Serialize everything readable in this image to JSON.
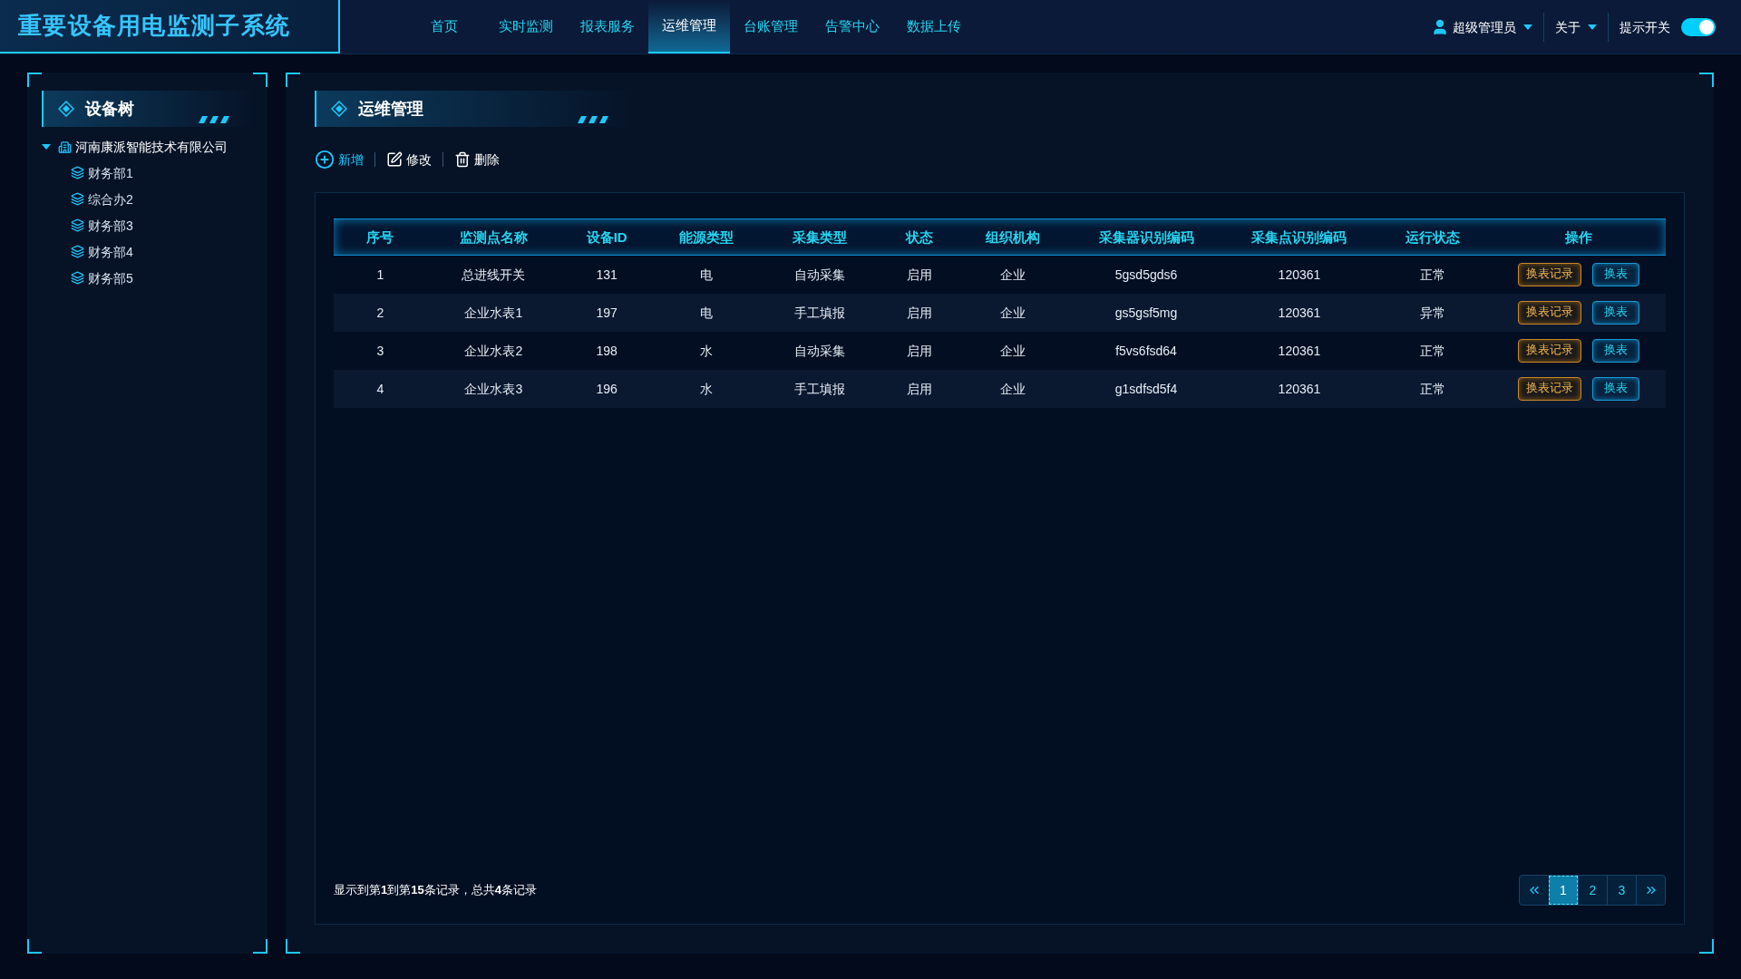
{
  "app_title": "重要设备用电监测子系统",
  "nav": [
    {
      "label": "首页",
      "selected": false
    },
    {
      "label": "实时监测",
      "selected": false
    },
    {
      "label": "报表服务",
      "selected": false
    },
    {
      "label": "运维管理",
      "selected": true
    },
    {
      "label": "台账管理",
      "selected": false
    },
    {
      "label": "告警中心",
      "selected": false
    },
    {
      "label": "数据上传",
      "selected": false
    }
  ],
  "user_menu": {
    "label": "超级管理员"
  },
  "about_menu": {
    "label": "关于"
  },
  "hint_toggle": {
    "label": "提示开关",
    "on": true
  },
  "sidebar": {
    "title": "设备树",
    "tree": [
      {
        "label": "河南康派智能技术有限公司",
        "expanded": true,
        "children": [
          {
            "label": "财务部1"
          },
          {
            "label": "综合办2"
          },
          {
            "label": "财务部3"
          },
          {
            "label": "财务部4"
          },
          {
            "label": "财务部5"
          }
        ]
      }
    ]
  },
  "main": {
    "title": "运维管理",
    "toolbar": [
      {
        "kind": "add",
        "label": "新增"
      },
      {
        "kind": "edit",
        "label": "修改"
      },
      {
        "kind": "delete",
        "label": "删除"
      }
    ],
    "table": {
      "columns": [
        "序号",
        "监测点名称",
        "设备ID",
        "能源类型",
        "采集类型",
        "状态",
        "组织机构",
        "采集器识别编码",
        "采集点识别编码",
        "运行状态",
        "操作"
      ],
      "rows": [
        {
          "cells": [
            "1",
            "总进线开关",
            "131",
            "电",
            "自动采集",
            "启用",
            "企业",
            "5gsd5gds6",
            "120361",
            "正常"
          ],
          "actions": [
            "换表记录",
            "换表"
          ]
        },
        {
          "cells": [
            "2",
            "企业水表1",
            "197",
            "电",
            "手工填报",
            "启用",
            "企业",
            "gs5gsf5mg",
            "120361",
            "异常"
          ],
          "actions": [
            "换表记录",
            "换表"
          ]
        },
        {
          "cells": [
            "3",
            "企业水表2",
            "198",
            "水",
            "自动采集",
            "启用",
            "企业",
            "f5vs6fsd64",
            "120361",
            "正常"
          ],
          "actions": [
            "换表记录",
            "换表"
          ]
        },
        {
          "cells": [
            "4",
            "企业水表3",
            "196",
            "水",
            "手工填报",
            "启用",
            "企业",
            "g1sdfsd5f4",
            "120361",
            "正常"
          ],
          "actions": [
            "换表记录",
            "换表"
          ]
        }
      ]
    },
    "footer": "显示到第**1**到第**15**条记录，总共**4**条记录",
    "pagination": [
      {
        "label": "1",
        "selected": true
      },
      {
        "label": "2",
        "selected": false
      },
      {
        "label": "3",
        "selected": false
      }
    ]
  }
}
